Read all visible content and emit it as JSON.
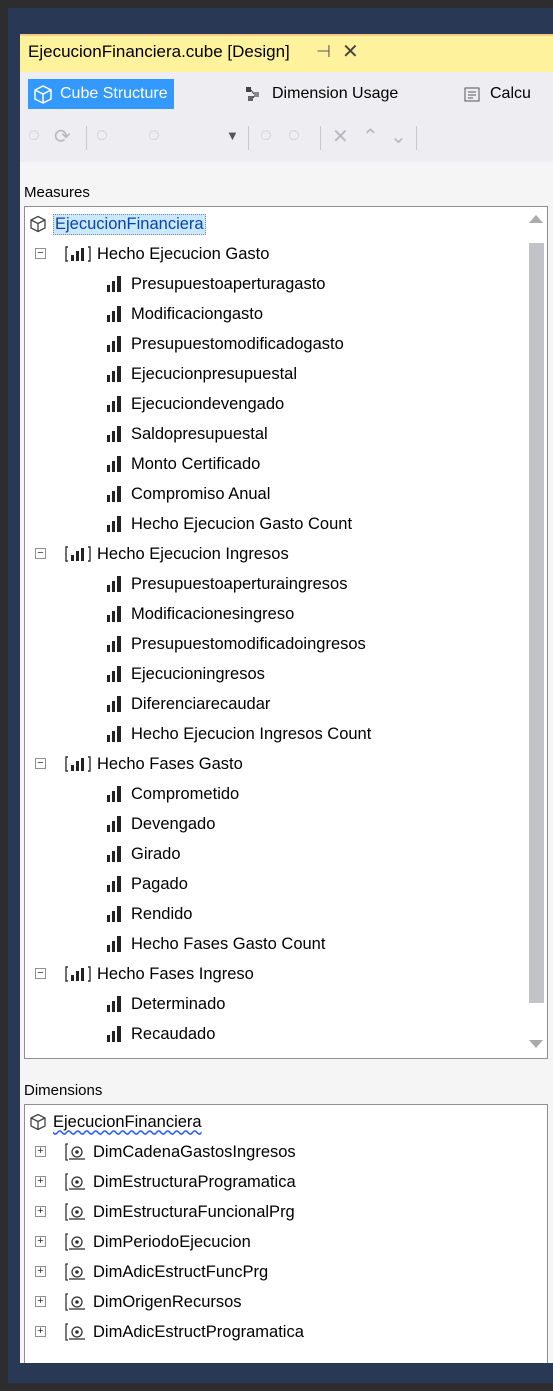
{
  "document_tab": {
    "title": "EjecucionFinanciera.cube [Design]",
    "pin_glyph": "⊣",
    "close_glyph": "✕"
  },
  "designer_tabs": [
    {
      "label": "Cube Structure",
      "icon": "cube-structure-icon",
      "active": true
    },
    {
      "label": "Dimension Usage",
      "icon": "dimension-usage-icon",
      "active": false
    },
    {
      "label": "Calcu",
      "icon": "calculations-icon",
      "active": false
    }
  ],
  "measures": {
    "section_label": "Measures",
    "root": "EjecucionFinanciera",
    "groups": [
      {
        "name": "Hecho Ejecucion Gasto",
        "items": [
          "Presupuestoaperturagasto",
          "Modificaciongasto",
          "Presupuestomodificadogasto",
          "Ejecucionpresupuestal",
          "Ejecuciondevengado",
          "Saldopresupuestal",
          "Monto Certificado",
          "Compromiso Anual",
          "Hecho Ejecucion Gasto Count"
        ]
      },
      {
        "name": "Hecho Ejecucion Ingresos",
        "items": [
          "Presupuestoaperturaingresos",
          "Modificacionesingreso",
          "Presupuestomodificadoingresos",
          "Ejecucioningresos",
          "Diferenciarecaudar",
          "Hecho Ejecucion Ingresos Count"
        ]
      },
      {
        "name": "Hecho Fases Gasto",
        "items": [
          "Comprometido",
          "Devengado",
          "Girado",
          "Pagado",
          "Rendido",
          "Hecho Fases Gasto Count"
        ]
      },
      {
        "name": "Hecho Fases Ingreso",
        "items": [
          "Determinado",
          "Recaudado"
        ]
      }
    ]
  },
  "dimensions": {
    "section_label": "Dimensions",
    "root": "EjecucionFinanciera",
    "items": [
      "DimCadenaGastosIngresos",
      "DimEstructuraProgramatica",
      "DimEstructuraFuncionalPrg",
      "DimPeriodoEjecucion",
      "DimAdicEstructFuncPrg",
      "DimOrigenRecursos",
      "DimAdicEstructProgramatica"
    ]
  }
}
